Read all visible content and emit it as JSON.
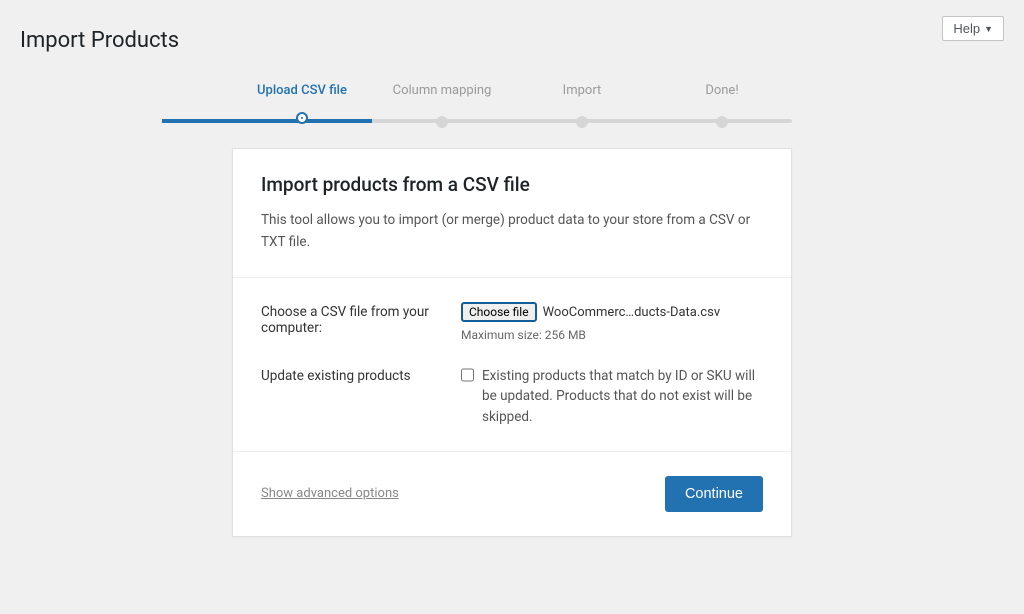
{
  "header": {
    "title": "Import Products",
    "help": "Help"
  },
  "steps": [
    "Upload CSV file",
    "Column mapping",
    "Import",
    "Done!"
  ],
  "active_step": 0,
  "panel": {
    "title": "Import products from a CSV file",
    "description": "This tool allows you to import (or merge) product data to your store from a CSV or TXT file.",
    "choose_label": "Choose a CSV file from your computer:",
    "choose_button": "Choose file",
    "chosen_filename": "WooCommerc…ducts-Data.csv",
    "max_size": "Maximum size: 256 MB",
    "update_label": "Update existing products",
    "update_desc": "Existing products that match by ID or SKU will be updated. Products that do not exist will be skipped.",
    "advanced": "Show advanced options",
    "continue": "Continue"
  }
}
